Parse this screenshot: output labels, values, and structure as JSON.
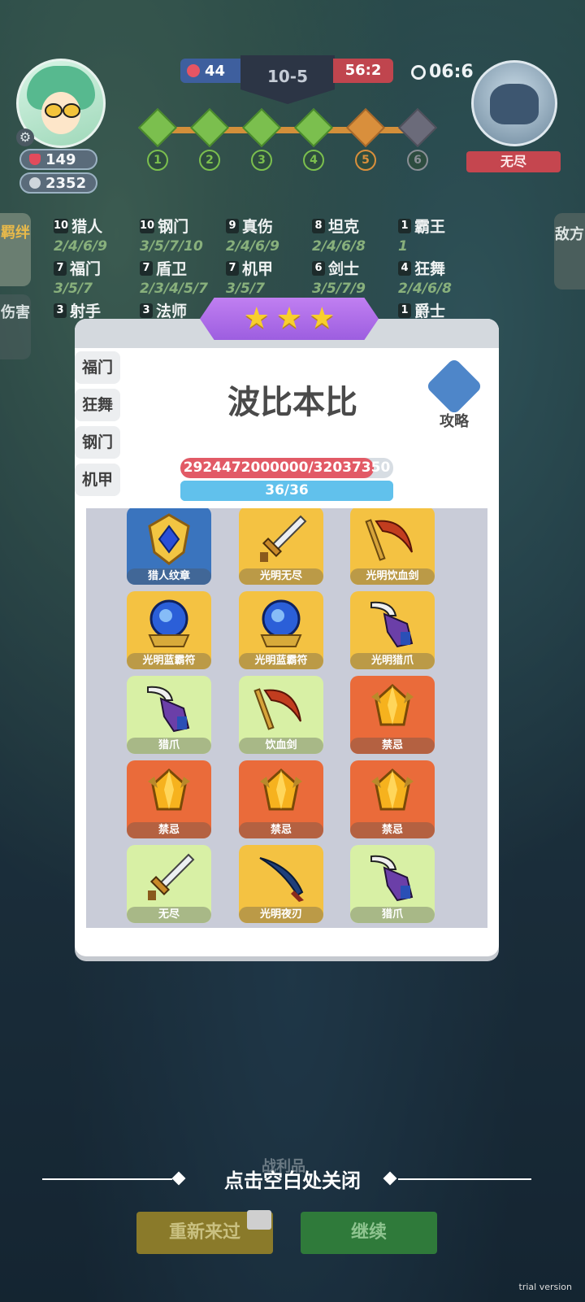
{
  "hud": {
    "hp": "149",
    "gold": "2352",
    "score_left": "44",
    "round": "10-5",
    "score_right": "56:2",
    "timer": "06:6",
    "enemy_label": "无尽",
    "stages": [
      "1",
      "2",
      "3",
      "4",
      "5",
      "6"
    ]
  },
  "tabs": {
    "bond": "羁绊",
    "damage": "伤害",
    "enemy": "敌方"
  },
  "synergy": [
    [
      {
        "count": "10",
        "name": "猎人",
        "tiers": "2/4/6/9"
      },
      {
        "count": "10",
        "name": "钢门",
        "tiers": "3/5/7/10"
      },
      {
        "count": "9",
        "name": "真伤",
        "tiers": "2/4/6/9"
      },
      {
        "count": "8",
        "name": "坦克",
        "tiers": "2/4/6/8"
      },
      {
        "count": "1",
        "name": "霸王",
        "tiers": "1"
      }
    ],
    [
      {
        "count": "7",
        "name": "福门",
        "tiers": "3/5/7"
      },
      {
        "count": "7",
        "name": "盾卫",
        "tiers": "2/3/4/5/7"
      },
      {
        "count": "7",
        "name": "机甲",
        "tiers": "3/5/7"
      },
      {
        "count": "6",
        "name": "剑士",
        "tiers": "3/5/7/9"
      },
      {
        "count": "4",
        "name": "狂舞",
        "tiers": "2/4/6/8"
      }
    ],
    [
      {
        "count": "3",
        "name": "射手",
        "tiers": ""
      },
      {
        "count": "3",
        "name": "法师",
        "tiers": ""
      },
      {
        "count": "",
        "name": "",
        "tiers": ""
      },
      {
        "count": "",
        "name": "",
        "tiers": ""
      },
      {
        "count": "1",
        "name": "爵士",
        "tiers": ""
      }
    ]
  ],
  "modal": {
    "stars": 3,
    "title": "波比本比",
    "guide_label": "攻略",
    "filters": [
      "福门",
      "狂舞",
      "钢门",
      "机甲"
    ],
    "hp_text": "2924472000000/32037350",
    "hp_fraction": 0.91,
    "energy_text": "36/36",
    "energy_fraction": 1.0,
    "items": [
      {
        "name": "猎人纹章",
        "rarity": "blue",
        "icon": "hunter-emblem-icon"
      },
      {
        "name": "光明无尽",
        "rarity": "gold",
        "icon": "sword-icon"
      },
      {
        "name": "光明饮血剑",
        "rarity": "gold",
        "icon": "scythe-icon"
      },
      {
        "name": "光明蓝霸符",
        "rarity": "gold",
        "icon": "orb-icon"
      },
      {
        "name": "光明蓝霸符",
        "rarity": "gold",
        "icon": "orb-icon"
      },
      {
        "name": "光明猎爪",
        "rarity": "gold",
        "icon": "claw-icon"
      },
      {
        "name": "猎爪",
        "rarity": "green",
        "icon": "claw-icon"
      },
      {
        "name": "饮血剑",
        "rarity": "green",
        "icon": "scythe-icon"
      },
      {
        "name": "禁忌",
        "rarity": "orange",
        "icon": "crystal-icon"
      },
      {
        "name": "禁忌",
        "rarity": "orange",
        "icon": "crystal-icon"
      },
      {
        "name": "禁忌",
        "rarity": "orange",
        "icon": "crystal-icon"
      },
      {
        "name": "禁忌",
        "rarity": "orange",
        "icon": "crystal-icon"
      },
      {
        "name": "无尽",
        "rarity": "green",
        "icon": "sword-icon"
      },
      {
        "name": "光明夜刃",
        "rarity": "gold",
        "icon": "blade-icon"
      },
      {
        "name": "猎爪",
        "rarity": "green",
        "icon": "claw-icon"
      }
    ]
  },
  "bottom": {
    "close_hint": "点击空白处关闭",
    "loot_faint": "战利品",
    "restart": "重新来过",
    "continue": "继续",
    "trial": "trial version"
  }
}
